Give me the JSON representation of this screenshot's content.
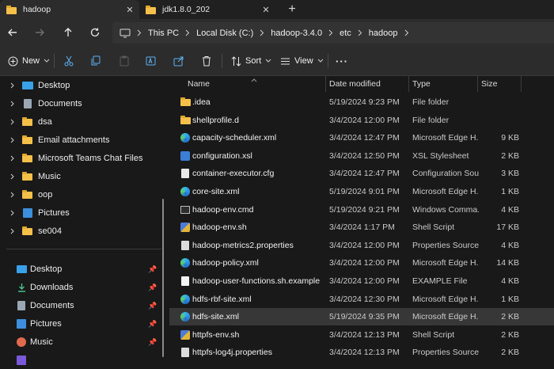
{
  "tabs": [
    {
      "label": "hadoop",
      "close": "✕"
    },
    {
      "label": "jdk1.8.0_202",
      "close": "✕"
    }
  ],
  "newtab_label": "+",
  "address": {
    "root": "This PC",
    "crumbs": [
      "Local Disk (C:)",
      "hadoop-3.4.0",
      "etc",
      "hadoop"
    ]
  },
  "commands": {
    "new_label": "New",
    "sort_label": "Sort",
    "view_label": "View",
    "more_label": "···"
  },
  "tree": [
    {
      "label": "Desktop",
      "icon": "desktop-icon"
    },
    {
      "label": "Documents",
      "icon": "documents-icon"
    },
    {
      "label": "dsa",
      "icon": "folder-icon"
    },
    {
      "label": "Email attachments",
      "icon": "folder-icon"
    },
    {
      "label": "Microsoft Teams Chat Files",
      "icon": "folder-icon"
    },
    {
      "label": "Music",
      "icon": "folder-icon"
    },
    {
      "label": "oop",
      "icon": "folder-icon"
    },
    {
      "label": "Pictures",
      "icon": "pictures-icon"
    },
    {
      "label": "se004",
      "icon": "folder-icon"
    }
  ],
  "quick_access": [
    {
      "label": "Desktop",
      "icon": "desktop-icon"
    },
    {
      "label": "Downloads",
      "icon": "downloads-icon"
    },
    {
      "label": "Documents",
      "icon": "documents-icon"
    },
    {
      "label": "Pictures",
      "icon": "pictures-icon"
    },
    {
      "label": "Music",
      "icon": "music-icon"
    }
  ],
  "columns": {
    "name": "Name",
    "date": "Date modified",
    "type": "Type",
    "size": "Size"
  },
  "files": [
    {
      "name": ".idea",
      "date": "5/19/2024 9:23 PM",
      "type": "File folder",
      "size": "",
      "icon": "folder"
    },
    {
      "name": "shellprofile.d",
      "date": "3/4/2024 12:00 PM",
      "type": "File folder",
      "size": "",
      "icon": "folder"
    },
    {
      "name": "capacity-scheduler.xml",
      "date": "3/4/2024 12:47 PM",
      "type": "Microsoft Edge H...",
      "size": "9 KB",
      "icon": "edge"
    },
    {
      "name": "configuration.xsl",
      "date": "3/4/2024 12:50 PM",
      "type": "XSL Stylesheet",
      "size": "2 KB",
      "icon": "xsl"
    },
    {
      "name": "container-executor.cfg",
      "date": "3/4/2024 12:47 PM",
      "type": "Configuration Sou...",
      "size": "3 KB",
      "icon": "cfg"
    },
    {
      "name": "core-site.xml",
      "date": "5/19/2024 9:01 PM",
      "type": "Microsoft Edge H...",
      "size": "1 KB",
      "icon": "edge"
    },
    {
      "name": "hadoop-env.cmd",
      "date": "5/19/2024 9:21 PM",
      "type": "Windows Comma...",
      "size": "4 KB",
      "icon": "cmd"
    },
    {
      "name": "hadoop-env.sh",
      "date": "3/4/2024 1:17 PM",
      "type": "Shell Script",
      "size": "17 KB",
      "icon": "sh"
    },
    {
      "name": "hadoop-metrics2.properties",
      "date": "3/4/2024 12:00 PM",
      "type": "Properties Source ...",
      "size": "4 KB",
      "icon": "props"
    },
    {
      "name": "hadoop-policy.xml",
      "date": "3/4/2024 12:00 PM",
      "type": "Microsoft Edge H...",
      "size": "14 KB",
      "icon": "edge"
    },
    {
      "name": "hadoop-user-functions.sh.example",
      "date": "3/4/2024 12:00 PM",
      "type": "EXAMPLE File",
      "size": "4 KB",
      "icon": "doc"
    },
    {
      "name": "hdfs-rbf-site.xml",
      "date": "3/4/2024 12:30 PM",
      "type": "Microsoft Edge H...",
      "size": "1 KB",
      "icon": "edge"
    },
    {
      "name": "hdfs-site.xml",
      "date": "5/19/2024 9:35 PM",
      "type": "Microsoft Edge H...",
      "size": "2 KB",
      "icon": "edge",
      "selected": true
    },
    {
      "name": "httpfs-env.sh",
      "date": "3/4/2024 12:13 PM",
      "type": "Shell Script",
      "size": "2 KB",
      "icon": "sh"
    },
    {
      "name": "httpfs-log4j.properties",
      "date": "3/4/2024 12:13 PM",
      "type": "Properties Source ...",
      "size": "2 KB",
      "icon": "props"
    }
  ],
  "colors": {
    "background": "#191919",
    "toolbar": "#2c2c2c",
    "selected_row": "#373737",
    "folder": "#f5c04a"
  }
}
